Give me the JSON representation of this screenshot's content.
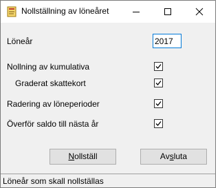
{
  "window": {
    "title": "Nollställning av löneåret"
  },
  "form": {
    "year_label": "Löneår",
    "year_value": "2017",
    "options": [
      {
        "label": "Nollning av kumulativa",
        "checked": true
      },
      {
        "label": "Graderat skattekort",
        "checked": true
      },
      {
        "label": "Radering av löneperioder",
        "checked": true
      },
      {
        "label": "Överför saldo till nästa år",
        "checked": true
      }
    ]
  },
  "buttons": {
    "reset_label_mnemonic": "N",
    "reset_label_rest": "ollställ",
    "exit_label_pre": "Av",
    "exit_label_mnemonic": "s",
    "exit_label_post": "luta"
  },
  "statusbar": {
    "text": "Löneår som skall nollställas"
  },
  "icons": {
    "app": "app-icon",
    "minimize": "minimize-icon",
    "maximize": "maximize-icon",
    "close": "close-icon",
    "checkmark": "checkmark-icon"
  },
  "colors": {
    "focus_border": "#0078d7",
    "button_face": "#e1e1e1",
    "window_face": "#f0f0f0"
  }
}
